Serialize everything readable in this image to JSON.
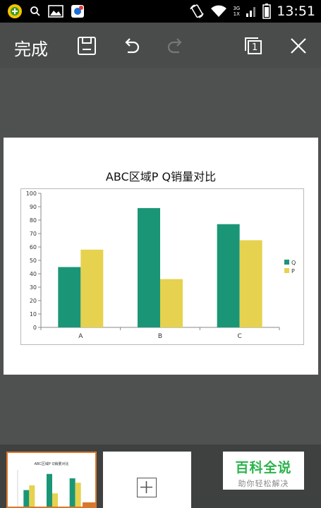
{
  "status_bar": {
    "time": "13:51",
    "network_top": "3G",
    "network_bottom": "1X",
    "icons": [
      "app-launcher-icon",
      "search-icon",
      "gallery-icon",
      "notification-app-icon",
      "rotate-icon",
      "wifi-icon",
      "signal-icon",
      "battery-icon"
    ]
  },
  "toolbar": {
    "done_label": "完成",
    "icons": [
      "save-icon",
      "undo-icon",
      "redo-icon",
      "page-count-icon",
      "close-icon"
    ],
    "page_count": "1",
    "redo_enabled": false
  },
  "chart_data": {
    "type": "bar",
    "title": "ABC区域P Q销量对比",
    "categories": [
      "A",
      "B",
      "C"
    ],
    "series": [
      {
        "name": "Q",
        "values": [
          45,
          89,
          77
        ],
        "color": "#1a9676"
      },
      {
        "name": "P",
        "values": [
          58,
          36,
          65
        ],
        "color": "#e6d24e"
      }
    ],
    "ylim": [
      0,
      100
    ],
    "yticks": [
      0,
      10,
      20,
      30,
      40,
      50,
      60,
      70,
      80,
      90,
      100
    ],
    "legend_position": "right",
    "grid": false
  },
  "thumbnail": {
    "title": "ABC区域P Q销量对比"
  },
  "watermark": {
    "main": "百科全说",
    "sub": "助你轻松解决"
  },
  "colors": {
    "toolbar_bg": "#4a4c4c",
    "status_bg": "#000000",
    "series_q": "#1a9676",
    "series_p": "#e6d24e",
    "accent": "#d9782c",
    "watermark_green": "#2bb34b"
  }
}
